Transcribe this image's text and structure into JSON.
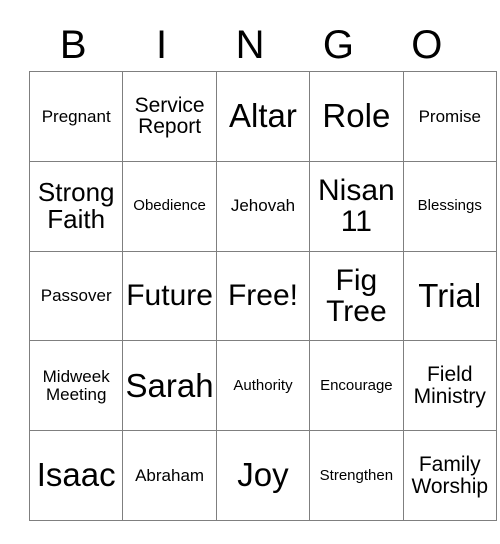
{
  "card": {
    "header_letters": [
      "B",
      "I",
      "N",
      "G",
      "O"
    ],
    "rows": [
      [
        {
          "text": "Pregnant",
          "size": "s"
        },
        {
          "text": "Service\nReport",
          "size": "m"
        },
        {
          "text": "Altar",
          "size": "xxl"
        },
        {
          "text": "Role",
          "size": "xxl"
        },
        {
          "text": "Promise",
          "size": "s"
        }
      ],
      [
        {
          "text": "Strong\nFaith",
          "size": "l"
        },
        {
          "text": "Obedience",
          "size": "xs"
        },
        {
          "text": "Jehovah",
          "size": "s"
        },
        {
          "text": "Nisan\n11",
          "size": "xl"
        },
        {
          "text": "Blessings",
          "size": "xs"
        }
      ],
      [
        {
          "text": "Passover",
          "size": "s"
        },
        {
          "text": "Future",
          "size": "xl"
        },
        {
          "text": "Free!",
          "size": "xl"
        },
        {
          "text": "Fig\nTree",
          "size": "xl"
        },
        {
          "text": "Trial",
          "size": "xxl"
        }
      ],
      [
        {
          "text": "Midweek\nMeeting",
          "size": "s"
        },
        {
          "text": "Sarah",
          "size": "xxl"
        },
        {
          "text": "Authority",
          "size": "xs"
        },
        {
          "text": "Encourage",
          "size": "xs"
        },
        {
          "text": "Field\nMinistry",
          "size": "m"
        }
      ],
      [
        {
          "text": "Isaac",
          "size": "xxl"
        },
        {
          "text": "Abraham",
          "size": "s"
        },
        {
          "text": "Joy",
          "size": "xxl"
        },
        {
          "text": "Strengthen",
          "size": "xs"
        },
        {
          "text": "Family\nWorship",
          "size": "m"
        }
      ]
    ]
  },
  "colors": {
    "background": "#ffffff",
    "text": "#000000",
    "grid_line": "#7f7f7f"
  }
}
